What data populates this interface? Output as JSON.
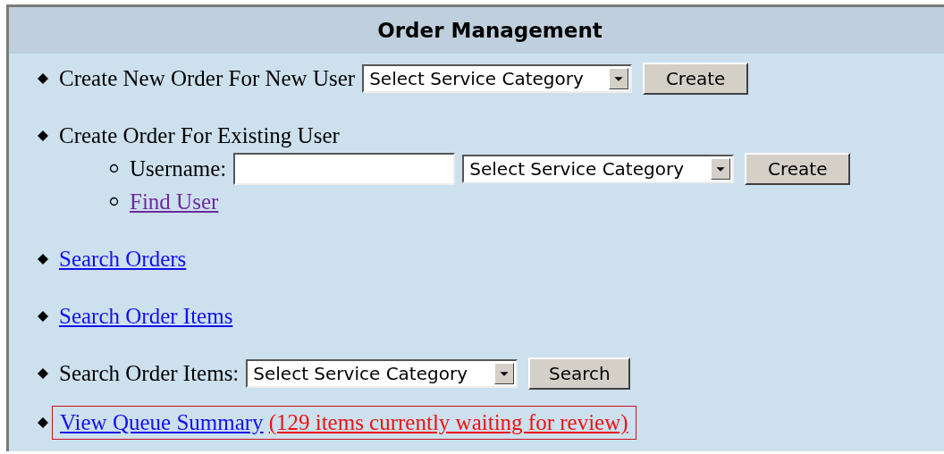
{
  "title": "Order Management",
  "items": [
    {
      "kind": "create",
      "label": "Create New Order For New User",
      "select": "Select Service Category",
      "button": "Create"
    },
    {
      "kind": "group",
      "label": "Create Order For Existing User",
      "children": [
        {
          "kind": "username",
          "label": "Username:",
          "select": "Select Service Category",
          "button": "Create"
        },
        {
          "kind": "link",
          "link": "Find User",
          "visited": true
        }
      ]
    },
    {
      "kind": "link",
      "link": "Search Orders",
      "visited": false
    },
    {
      "kind": "link",
      "link": "Search Order Items",
      "visited": false
    },
    {
      "kind": "create",
      "label": "Search Order Items:",
      "select": "Select Service Category",
      "button": "Search"
    },
    {
      "kind": "queue",
      "link": "View Queue Summary",
      "note": "(129 items currently waiting for review)",
      "highlighted": true
    }
  ]
}
